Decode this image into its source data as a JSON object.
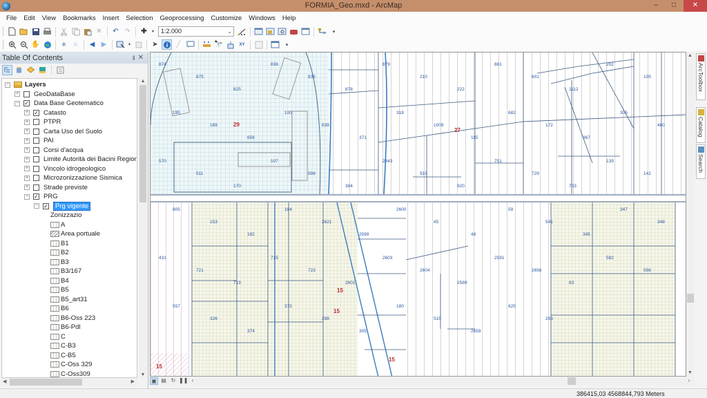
{
  "window": {
    "title": "FORMIA_Geo.mxd - ArcMap",
    "minimize": "–",
    "maximize": "□",
    "close": "✕"
  },
  "menu": [
    "File",
    "Edit",
    "View",
    "Bookmarks",
    "Insert",
    "Selection",
    "Geoprocessing",
    "Customize",
    "Windows",
    "Help"
  ],
  "toolbar": {
    "scale_value": "1:2.000",
    "standard_icons": [
      "new-document-icon",
      "open-icon",
      "save-icon",
      "print-icon",
      "cut-icon",
      "copy-icon",
      "paste-icon",
      "delete-icon",
      "undo-icon",
      "redo-icon",
      "add-data-icon"
    ],
    "tools_icons": [
      "zoom-in-icon",
      "zoom-out-icon",
      "pan-icon",
      "full-extent-icon",
      "fixed-zoom-in-icon",
      "fixed-zoom-out-icon",
      "back-icon",
      "forward-icon",
      "select-features-icon",
      "clear-selection-icon",
      "select-elements-icon",
      "identify-icon",
      "html-popup-icon",
      "measure-icon",
      "find-icon",
      "find-route-icon",
      "go-to-xy-icon",
      "time-slider-icon",
      "create-viewer-icon"
    ]
  },
  "toc": {
    "title": "Table Of Contents",
    "pin": "‖",
    "close": "✕",
    "tree": [
      {
        "label": "Layers",
        "level": 0,
        "expander": "−",
        "checkbox": null,
        "bold": true,
        "icon": "layers"
      },
      {
        "label": "GeoDataBase",
        "level": 1,
        "expander": "+",
        "checkbox": false
      },
      {
        "label": "Data Base Geotematico",
        "level": 1,
        "expander": "−",
        "checkbox": true
      },
      {
        "label": "Catasto",
        "level": 2,
        "expander": "+",
        "checkbox": true
      },
      {
        "label": "PTPR",
        "level": 2,
        "expander": "+",
        "checkbox": false
      },
      {
        "label": "Carta Uso del Suolo",
        "level": 2,
        "expander": "+",
        "checkbox": false
      },
      {
        "label": "PAI",
        "level": 2,
        "expander": "+",
        "checkbox": false
      },
      {
        "label": "Corsi d'acqua",
        "level": 2,
        "expander": "+",
        "checkbox": false
      },
      {
        "label": "Limite Autorità dei Bacini Regional",
        "level": 2,
        "expander": "+",
        "checkbox": false
      },
      {
        "label": "Vincolo idrogeologico",
        "level": 2,
        "expander": "+",
        "checkbox": false
      },
      {
        "label": "Microzonizzazione Sismica",
        "level": 2,
        "expander": "+",
        "checkbox": false
      },
      {
        "label": "Strade previste",
        "level": 2,
        "expander": "+",
        "checkbox": false
      },
      {
        "label": "PRG",
        "level": 2,
        "expander": "−",
        "checkbox": true
      },
      {
        "label": "Prg vigente",
        "level": 3,
        "expander": "−",
        "checkbox": true,
        "selected": true
      }
    ],
    "legend_heading": "Zonizzazio",
    "legend": [
      "A",
      "Area portuale",
      "B1",
      "B2",
      "B3",
      "B3/167",
      "B4",
      "B5",
      "B5_art31",
      "B6",
      "B6-Oss 223",
      "B6-Pdl",
      "C",
      "C-B3",
      "C-B5",
      "C-Oss 329",
      "C-Oss309"
    ]
  },
  "dock": [
    "ArcToolbox",
    "Catalog",
    "Search"
  ],
  "status": {
    "coordinates": "386415,03  4568844,793 Meters"
  },
  "map": {
    "zone_labels": [
      "29",
      "27",
      "15",
      "15",
      "15",
      "15"
    ],
    "parcel_labels": [
      "874",
      "875",
      "825",
      "836",
      "835",
      "878",
      "879",
      "210",
      "222",
      "881",
      "601",
      "1112",
      "202",
      "105",
      "195",
      "169",
      "656",
      "100",
      "638",
      "371",
      "318",
      "1009",
      "115",
      "682",
      "172",
      "367",
      "305",
      "460",
      "570",
      "511",
      "170",
      "107",
      "598",
      "384",
      "2643",
      "919",
      "920",
      "751",
      "729",
      "733",
      "139",
      "142",
      "805",
      "153",
      "182",
      "184",
      "2621",
      "2599",
      "2600",
      "45",
      "48",
      "59",
      "541",
      "345",
      "347",
      "348",
      "431",
      "721",
      "719",
      "715",
      "723",
      "2601",
      "2603",
      "2604",
      "2589",
      "2591",
      "2656",
      "83",
      "582",
      "556",
      "557",
      "326",
      "374",
      "375",
      "298",
      "305",
      "180",
      "515",
      "2659",
      "825",
      "283"
    ]
  }
}
